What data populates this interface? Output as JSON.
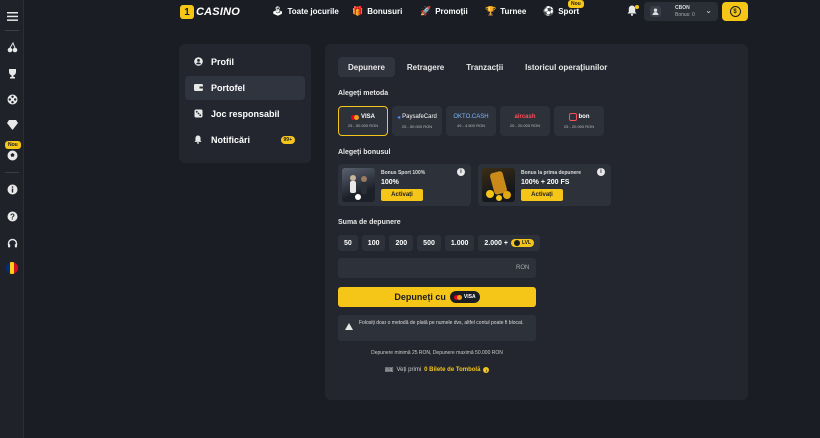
{
  "rail": {
    "icons": [
      "menu-icon",
      "cherries-icon",
      "trophy-icon",
      "film-reel-icon",
      "diamond-icon",
      "soccer-ball-icon",
      "info-icon",
      "help-icon",
      "support-icon",
      "romania-flag-icon"
    ],
    "nou_badge": "Nou"
  },
  "header": {
    "logo_mark": "1",
    "logo_text": "CASINO",
    "nav": [
      {
        "label": "Toate jocurile",
        "icon": "joystick-icon"
      },
      {
        "label": "Bonusuri",
        "icon": "gift-icon"
      },
      {
        "label": "Promoții",
        "icon": "rocket-icon"
      },
      {
        "label": "Turnee",
        "icon": "trophy-icon"
      },
      {
        "label": "Sport",
        "icon": "soccer-ball-icon"
      }
    ],
    "sport_badge": "Nou",
    "account": {
      "line1": "CBON",
      "line2": "Bonus: 0"
    }
  },
  "menu": {
    "items": [
      {
        "label": "Profil"
      },
      {
        "label": "Portofel"
      },
      {
        "label": "Joc responsabil"
      },
      {
        "label": "Notificări",
        "badge": "99+"
      }
    ]
  },
  "tabs": [
    "Depunere",
    "Retragere",
    "Tranzacții",
    "Istoricul operațiunilor"
  ],
  "methods_title": "Alegeți metoda",
  "methods": [
    {
      "name": "VISA",
      "range": "25 - 50.000 RON"
    },
    {
      "name": "PaysafeCard",
      "range": "25 - 50.000 RON"
    },
    {
      "name": "OKTO.CASH",
      "range": "49 - 4.500 RON"
    },
    {
      "name": "aircash",
      "range": "25 - 20.000 RON"
    },
    {
      "name": "bon",
      "range": "25 - 20.000 RON"
    }
  ],
  "bonus_title": "Alegeți bonusul",
  "bonuses": [
    {
      "title": "Bonus Sport 100%",
      "value": "100%",
      "action": "Activați"
    },
    {
      "title": "Bonus la prima depunere",
      "value": "100% + 200 FS",
      "action": "Activați"
    }
  ],
  "amount_title": "Suma de depunere",
  "amounts": [
    "50",
    "100",
    "200",
    "500",
    "1.000",
    "2.000 +"
  ],
  "lvl_label": "LVL",
  "currency": "RON",
  "deposit_button": "Depuneți cu",
  "deposit_card": "VISA",
  "warning": "Folosiți doar o metodă de plată pe numele dvs, altfel contul poate fi blocat.",
  "limits": "Depunere minimă 25 RON, Depunere maximă 50.000 RON",
  "tickets": {
    "prefix": "Veți primi",
    "highlight": "0 Bilete de Tombolă"
  },
  "colors": {
    "accent": "#f5c518",
    "background": "#1a1d24",
    "panel": "#23262e",
    "card": "#2d313a"
  }
}
